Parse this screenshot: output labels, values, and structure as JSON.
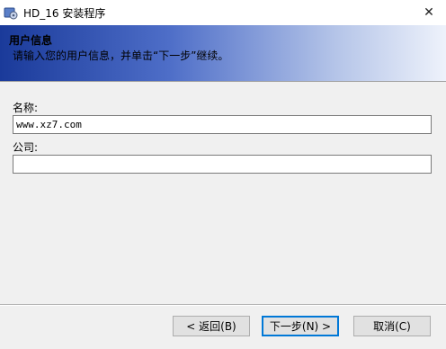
{
  "window": {
    "title": "HD_16 安装程序",
    "close_glyph": "✕"
  },
  "header": {
    "title": "用户信息",
    "description": "请输入您的用户信息，并单击“下一步”继续。"
  },
  "form": {
    "name_label": "名称:",
    "name_value": "www.xz7.com",
    "company_label": "公司:",
    "company_value": ""
  },
  "buttons": {
    "back": "< 返回(B)",
    "next": "下一步(N) >",
    "cancel": "取消(C)"
  },
  "colors": {
    "header_gradient_start": "#1a3a9a",
    "header_gradient_end": "#eef2fb",
    "default_button_border": "#0078d7"
  }
}
